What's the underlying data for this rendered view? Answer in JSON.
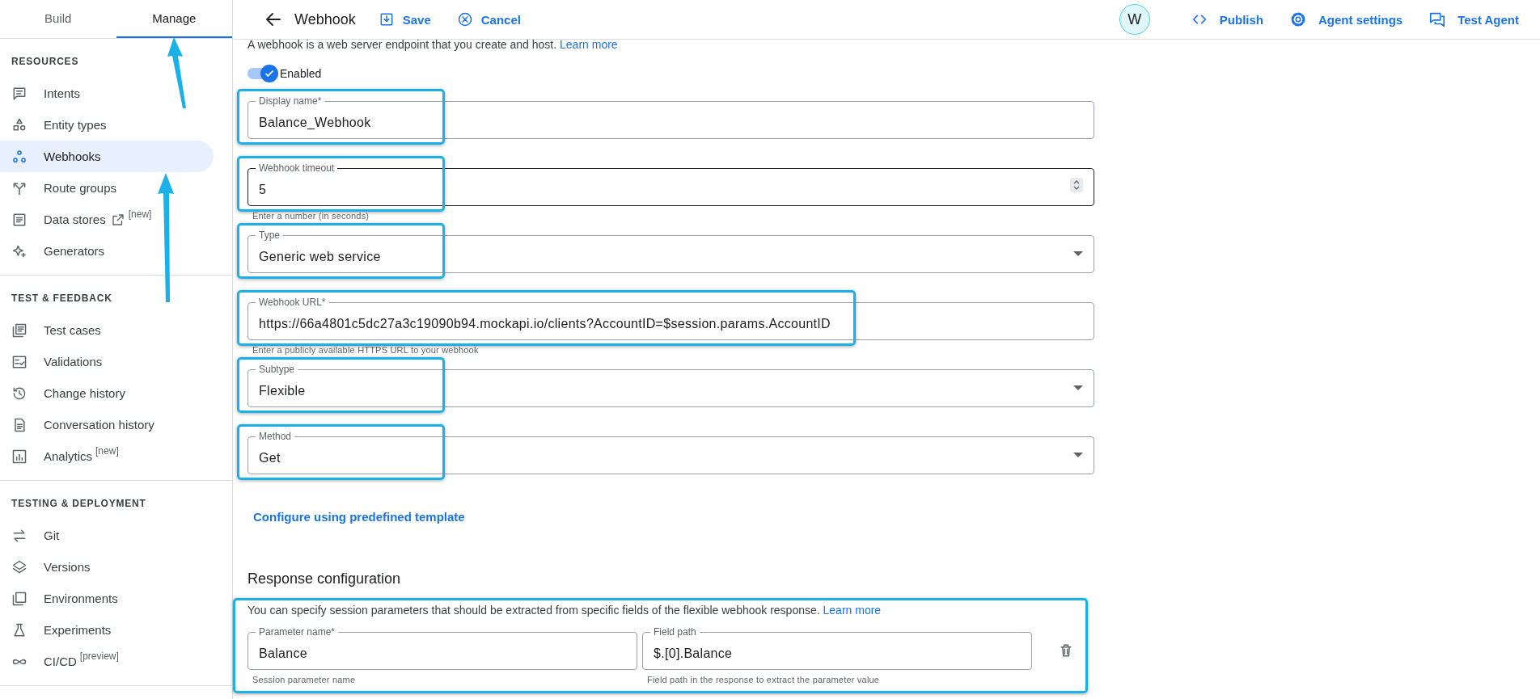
{
  "sidebar": {
    "tabs": [
      {
        "label": "Build",
        "selected": false
      },
      {
        "label": "Manage",
        "selected": true
      }
    ],
    "sections": [
      {
        "title": "RESOURCES",
        "items": [
          {
            "label": "Intents",
            "kind": "intents",
            "external_link": false,
            "selected": false
          },
          {
            "label": "Entity types",
            "kind": "entity",
            "external_link": false,
            "selected": false
          },
          {
            "label": "Webhooks",
            "kind": "webhooks",
            "external_link": false,
            "selected": true
          },
          {
            "label": "Route groups",
            "kind": "route",
            "external_link": false,
            "selected": false
          },
          {
            "label": "Data stores",
            "kind": "datastore",
            "badge": "[new]",
            "external_link": true,
            "selected": false
          },
          {
            "label": "Generators",
            "kind": "generators",
            "external_link": false,
            "selected": false
          }
        ]
      },
      {
        "title": "TEST & FEEDBACK",
        "items": [
          {
            "label": "Test cases",
            "kind": "testcases",
            "external_link": false,
            "selected": false
          },
          {
            "label": "Validations",
            "kind": "validations",
            "external_link": false,
            "selected": false
          },
          {
            "label": "Change history",
            "kind": "history",
            "external_link": false,
            "selected": false
          },
          {
            "label": "Conversation history",
            "kind": "conversation",
            "external_link": false,
            "selected": false
          },
          {
            "label": "Analytics",
            "kind": "analytics",
            "badge": "[new]",
            "external_link": false,
            "selected": false
          }
        ]
      },
      {
        "title": "TESTING & DEPLOYMENT",
        "items": [
          {
            "label": "Git",
            "kind": "git",
            "external_link": false,
            "selected": false
          },
          {
            "label": "Versions",
            "kind": "versions",
            "external_link": false,
            "selected": false
          },
          {
            "label": "Environments",
            "kind": "environments",
            "external_link": false,
            "selected": false
          },
          {
            "label": "Experiments",
            "kind": "experiments",
            "external_link": false,
            "selected": false
          },
          {
            "label": "CI/CD",
            "kind": "cicd",
            "badge": "[preview]",
            "external_link": false,
            "selected": false
          }
        ]
      }
    ]
  },
  "header": {
    "title": "Webhook",
    "actions": [
      {
        "label": "Save",
        "kind": "save"
      },
      {
        "label": "Cancel",
        "kind": "cancel"
      }
    ],
    "avatar": "W",
    "right_actions": [
      {
        "label": "Publish",
        "kind": "code"
      },
      {
        "label": "Agent settings",
        "kind": "settings"
      },
      {
        "label": "Test Agent",
        "kind": "chat"
      }
    ]
  },
  "form": {
    "description": "A webhook is a web server endpoint that you create and host.",
    "learn_more": "Learn more",
    "enabled": {
      "label": "Enabled",
      "on": true
    },
    "fields": [
      {
        "kind": "text",
        "label": "Display name*",
        "value": "Balance_Webhook",
        "focused": false,
        "highlighted": true
      },
      {
        "kind": "number",
        "label": "Webhook timeout",
        "value": "5",
        "hint": "Enter a number (in seconds)",
        "focused": true,
        "highlighted": true
      },
      {
        "kind": "select",
        "label": "Type",
        "value": "Generic web service",
        "focused": false,
        "highlighted": true
      },
      {
        "kind": "text",
        "label": "Webhook URL*",
        "value": "https://66a4801c5dc27a3c19090b94.mockapi.io/clients?AccountID=$session.params.AccountID",
        "hint": "Enter a publicly available HTTPS URL to your webhook",
        "focused": false,
        "highlighted": true
      },
      {
        "kind": "select",
        "label": "Subtype",
        "value": "Flexible",
        "focused": false,
        "highlighted": true
      },
      {
        "kind": "select",
        "label": "Method",
        "value": "Get",
        "focused": false,
        "highlighted": true
      }
    ],
    "template_link": "Configure using predefined template",
    "response_configuration": {
      "title": "Response configuration",
      "description": "You can specify session parameters that should be extracted from specific fields of the flexible webhook response.",
      "learn_more": "Learn more",
      "highlighted": true,
      "parameters": [
        {
          "name_label": "Parameter name*",
          "name": "Balance",
          "name_hint": "Session parameter name",
          "path_label": "Field path",
          "path": "$.[0].Balance",
          "path_hint": "Field path in the response to extract the parameter value"
        }
      ]
    }
  }
}
